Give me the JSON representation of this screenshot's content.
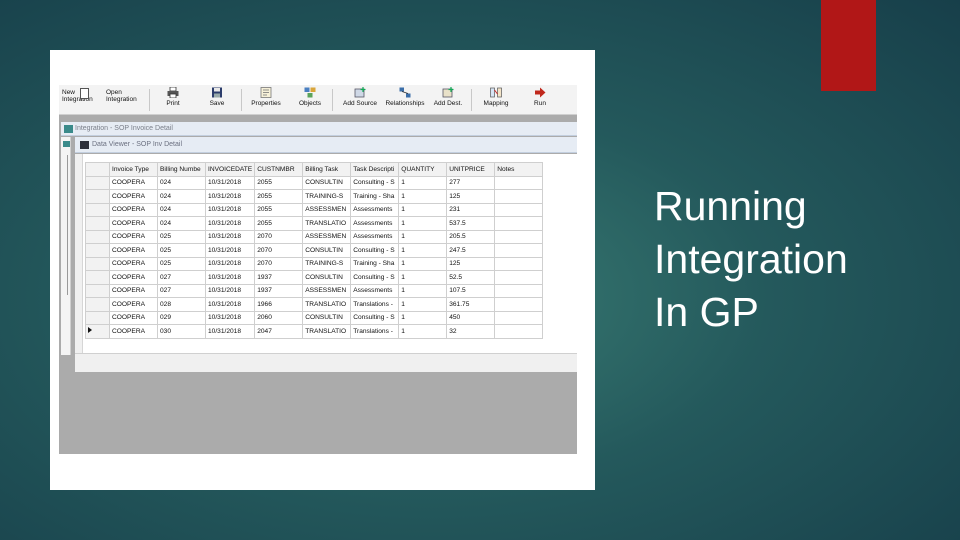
{
  "slide": {
    "title_lines": [
      "Running",
      "Integration",
      "In GP"
    ],
    "accent_color": "#b11717"
  },
  "toolbar": {
    "new_integration": {
      "line1": "New",
      "line2": "Integration"
    },
    "open_integration": {
      "line1": "Open",
      "line2": "Integration"
    },
    "buttons": [
      {
        "label": "Print",
        "icon": "printer-icon"
      },
      {
        "label": "Save",
        "icon": "save-icon"
      },
      {
        "label": "Properties",
        "icon": "properties-icon"
      },
      {
        "label": "Objects",
        "icon": "objects-icon"
      },
      {
        "label": "Add Source",
        "icon": "add-source-icon"
      },
      {
        "label": "Relationships",
        "icon": "relationships-icon"
      },
      {
        "label": "Add Dest.",
        "icon": "add-destination-icon"
      },
      {
        "label": "Mapping",
        "icon": "mapping-icon"
      },
      {
        "label": "Run",
        "icon": "run-arrow-icon"
      }
    ]
  },
  "windows": {
    "integration_title": "Integration - SOP Invoice Detail",
    "data_viewer_title": "Data Viewer - SOP Inv Detail"
  },
  "grid": {
    "columns": [
      "Invoice Type",
      "Billing Numbe",
      "INVOICEDATE",
      "CUSTNMBR",
      "Billing Task",
      "Task Descripti",
      "QUANTITY",
      "UNITPRICE",
      "Notes"
    ],
    "rows": [
      [
        "COOPERA",
        "024",
        "10/31/2018",
        "2055",
        "CONSULTIN",
        "Consulting - S",
        "1",
        "277",
        ""
      ],
      [
        "COOPERA",
        "024",
        "10/31/2018",
        "2055",
        "TRAINING-S",
        "Training - Sha",
        "1",
        "125",
        ""
      ],
      [
        "COOPERA",
        "024",
        "10/31/2018",
        "2055",
        "ASSESSMEN",
        "Assessments",
        "1",
        "231",
        ""
      ],
      [
        "COOPERA",
        "024",
        "10/31/2018",
        "2055",
        "TRANSLATIO",
        "Assessments",
        "1",
        "537.5",
        ""
      ],
      [
        "COOPERA",
        "025",
        "10/31/2018",
        "2070",
        "ASSESSMEN",
        "Assessments",
        "1",
        "205.5",
        ""
      ],
      [
        "COOPERA",
        "025",
        "10/31/2018",
        "2070",
        "CONSULTIN",
        "Consulting - S",
        "1",
        "247.5",
        ""
      ],
      [
        "COOPERA",
        "025",
        "10/31/2018",
        "2070",
        "TRAINING-S",
        "Training - Sha",
        "1",
        "125",
        ""
      ],
      [
        "COOPERA",
        "027",
        "10/31/2018",
        "1937",
        "CONSULTIN",
        "Consulting - S",
        "1",
        "52.5",
        ""
      ],
      [
        "COOPERA",
        "027",
        "10/31/2018",
        "1937",
        "ASSESSMEN",
        "Assessments",
        "1",
        "107.5",
        ""
      ],
      [
        "COOPERA",
        "028",
        "10/31/2018",
        "1966",
        "TRANSLATIO",
        "Translations -",
        "1",
        "361.75",
        ""
      ],
      [
        "COOPERA",
        "029",
        "10/31/2018",
        "2060",
        "CONSULTIN",
        "Consulting - S",
        "1",
        "450",
        ""
      ],
      [
        "COOPERA",
        "030",
        "10/31/2018",
        "2047",
        "TRANSLATIO",
        "Translations -",
        "1",
        "32",
        ""
      ]
    ],
    "current_row_index": 11
  }
}
